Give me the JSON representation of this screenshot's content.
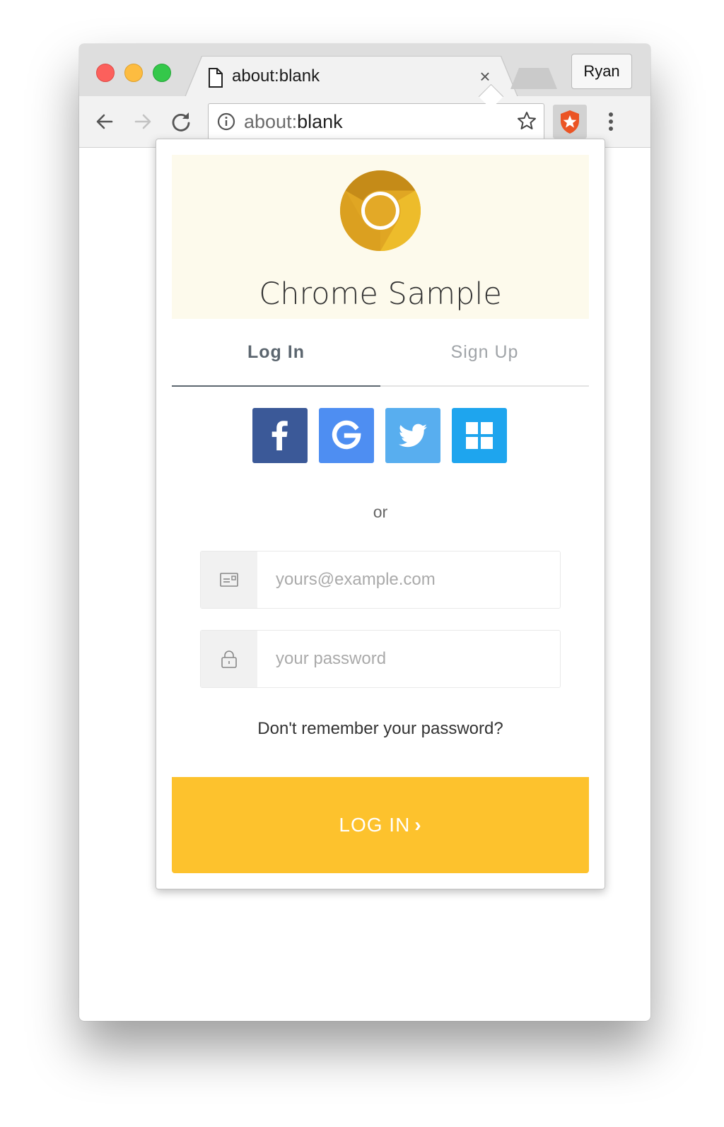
{
  "browser": {
    "tab_title": "about:blank",
    "tab_close": "×",
    "profile_name": "Ryan",
    "address": {
      "scheme": "about:",
      "rest": "blank"
    }
  },
  "popup": {
    "app_title": "Chrome Sample",
    "tabs": [
      {
        "label": "Log In",
        "active": true
      },
      {
        "label": "Sign Up",
        "active": false
      }
    ],
    "social": [
      {
        "provider": "facebook",
        "icon": "facebook-icon",
        "color": "#3b5998"
      },
      {
        "provider": "google",
        "icon": "google-icon",
        "color": "#4e8ef2"
      },
      {
        "provider": "twitter",
        "icon": "twitter-icon",
        "color": "#58aeef"
      },
      {
        "provider": "windows",
        "icon": "windows-icon",
        "color": "#1ea5ee"
      }
    ],
    "or_text": "or",
    "email": {
      "placeholder": "yours@example.com",
      "value": ""
    },
    "password": {
      "placeholder": "your password",
      "value": ""
    },
    "forgot_link": "Don't remember your password?",
    "submit_label": "LOG IN",
    "submit_chevron": "›",
    "accent_color": "#fdc22d"
  }
}
